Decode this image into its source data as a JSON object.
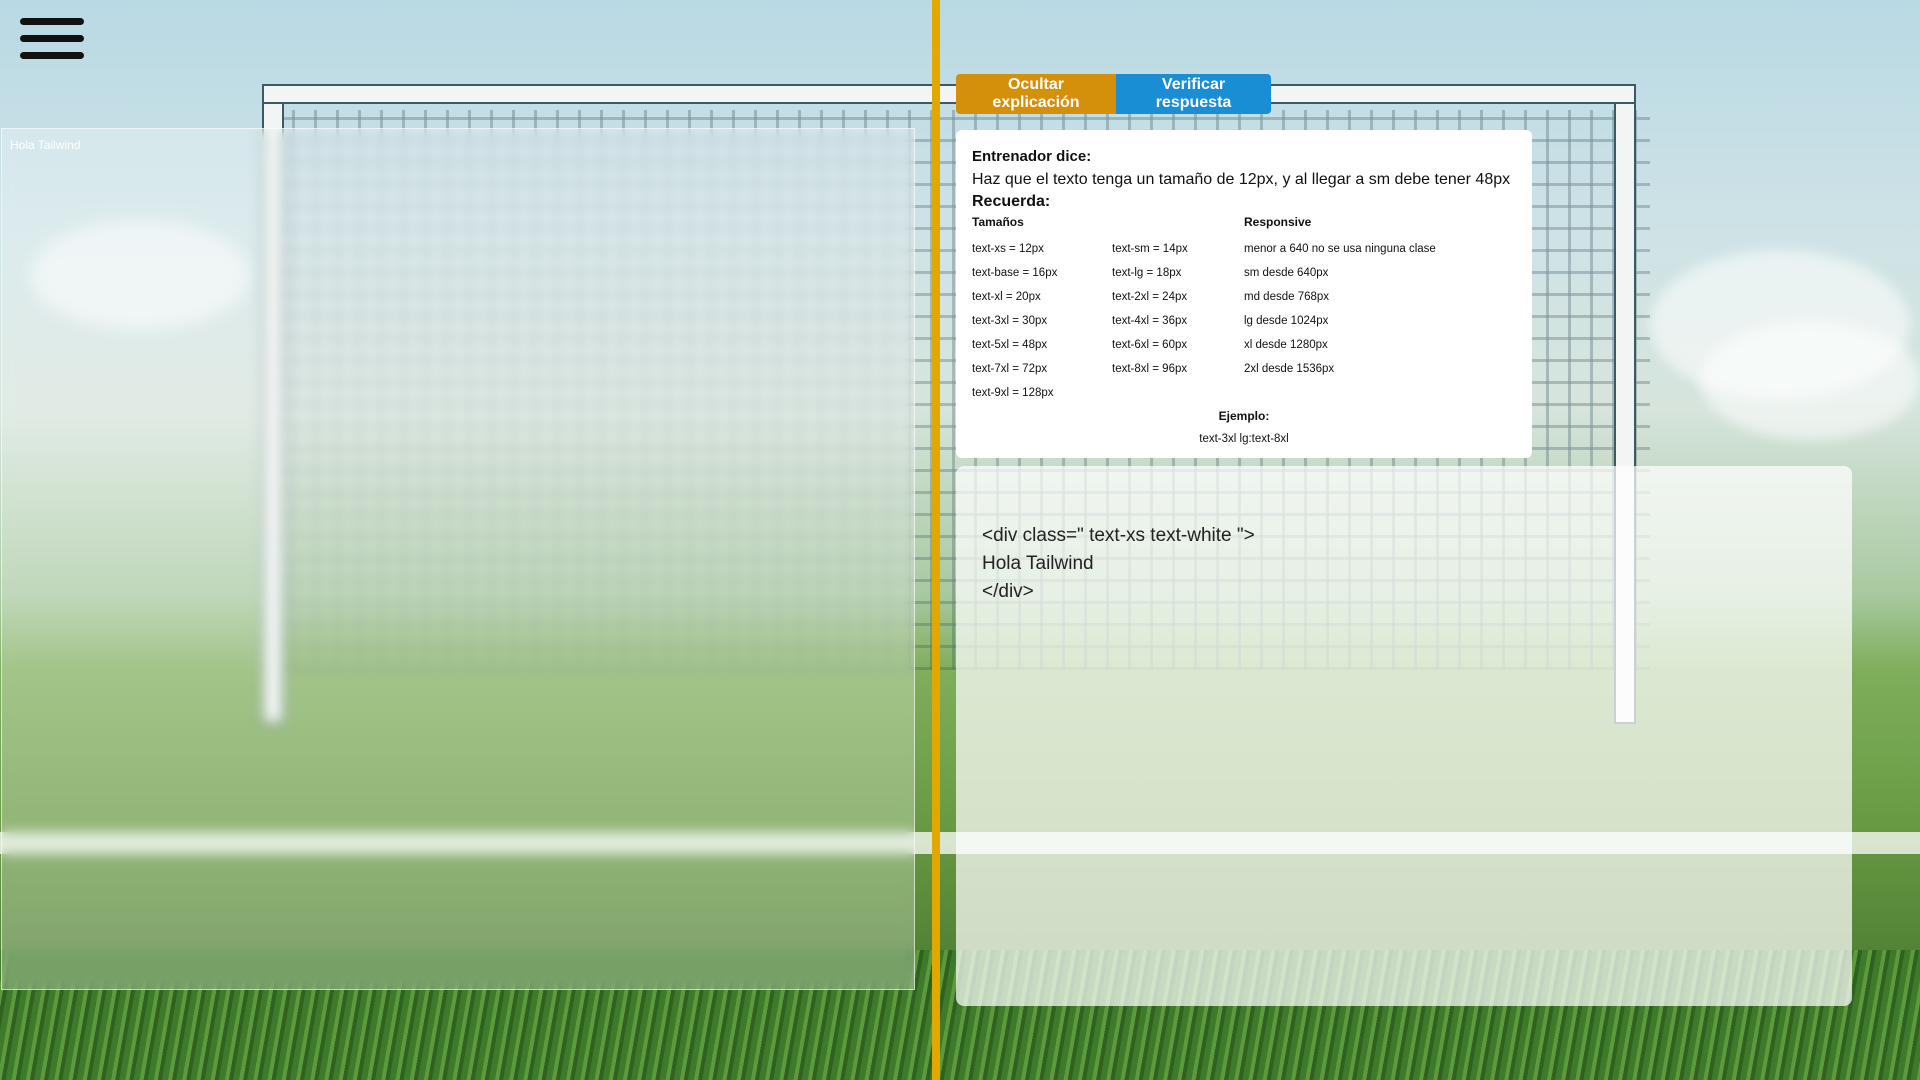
{
  "menu": {
    "icon": "hamburger-menu-icon"
  },
  "preview": {
    "text": "Hola Tailwind"
  },
  "actions": {
    "hide_label": "Ocultar explicación",
    "verify_label": "Verificar respuesta",
    "hide_color": "#d4900a",
    "verify_color": "#1a8ed4"
  },
  "explanation": {
    "coach_title": "Entrenador dice:",
    "task": "Haz que el texto tenga un tamaño de 12px, y al llegar a sm debe tener 48px",
    "remember_title": "Recuerda:",
    "sizes_title": "Tamaños",
    "sizes": [
      "text-xs = 12px",
      "text-sm = 14px",
      "text-base = 16px",
      "text-lg = 18px",
      "text-xl = 20px",
      "text-2xl = 24px",
      "text-3xl = 30px",
      "text-4xl = 36px",
      "text-5xl = 48px",
      "text-6xl = 60px",
      "text-7xl = 72px",
      "text-8xl = 96px",
      "text-9xl = 128px"
    ],
    "responsive_title": "Responsive",
    "responsive": [
      "menor a 640 no se usa ninguna clase",
      "sm desde 640px",
      "md desde 768px",
      "lg desde 1024px",
      "xl desde 1280px",
      "2xl desde 1536px"
    ],
    "example_title": "Ejemplo:",
    "example_code": "text-3xl lg:text-8xl"
  },
  "editor": {
    "line1": "<div class=\" text-xs text-white \">",
    "line2": "Hola Tailwind",
    "line3": "</div>"
  },
  "accent_color": "#e0a800"
}
